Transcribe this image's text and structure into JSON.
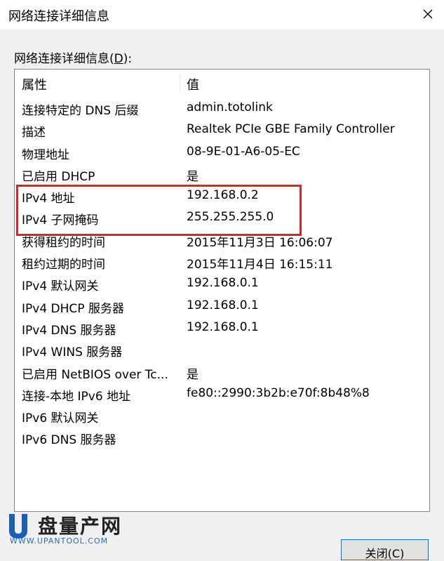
{
  "window": {
    "title": "网络连接详细信息"
  },
  "group_label": {
    "text": "网络连接详细信息(",
    "mnemonic": "D",
    "suffix": "):"
  },
  "table": {
    "columns": [
      "属性",
      "值"
    ],
    "rows": [
      {
        "property": "连接特定的 DNS 后缀",
        "value": "admin.totolink"
      },
      {
        "property": "描述",
        "value": "Realtek PCIe GBE Family Controller"
      },
      {
        "property": "物理地址",
        "value": "08-9E-01-A6-05-EC"
      },
      {
        "property": "已启用 DHCP",
        "value": "是"
      },
      {
        "property": "IPv4 地址",
        "value": "192.168.0.2"
      },
      {
        "property": "IPv4 子网掩码",
        "value": "255.255.255.0"
      },
      {
        "property": "获得租约的时间",
        "value": "2015年11月3日 16:06:07"
      },
      {
        "property": "租约过期的时间",
        "value": "2015年11月4日 16:15:11"
      },
      {
        "property": "IPv4 默认网关",
        "value": "192.168.0.1"
      },
      {
        "property": "IPv4 DHCP 服务器",
        "value": "192.168.0.1"
      },
      {
        "property": "IPv4 DNS 服务器",
        "value": "192.168.0.1"
      },
      {
        "property": "IPv4 WINS 服务器",
        "value": ""
      },
      {
        "property": "已启用 NetBIOS over Tc...",
        "value": "是"
      },
      {
        "property": "连接-本地 IPv6 地址",
        "value": "fe80::2990:3b2b:e70f:8b48%8"
      },
      {
        "property": "IPv6 默认网关",
        "value": ""
      },
      {
        "property": "IPv6 DNS 服务器",
        "value": ""
      }
    ]
  },
  "watermark": {
    "brand": "盘量产网",
    "url": "WWW.UPANTOOL.COM"
  },
  "buttons": {
    "close_label": "关闭(C)"
  },
  "colors": {
    "highlight": "#d8252b",
    "button_border": "#0078d7"
  }
}
